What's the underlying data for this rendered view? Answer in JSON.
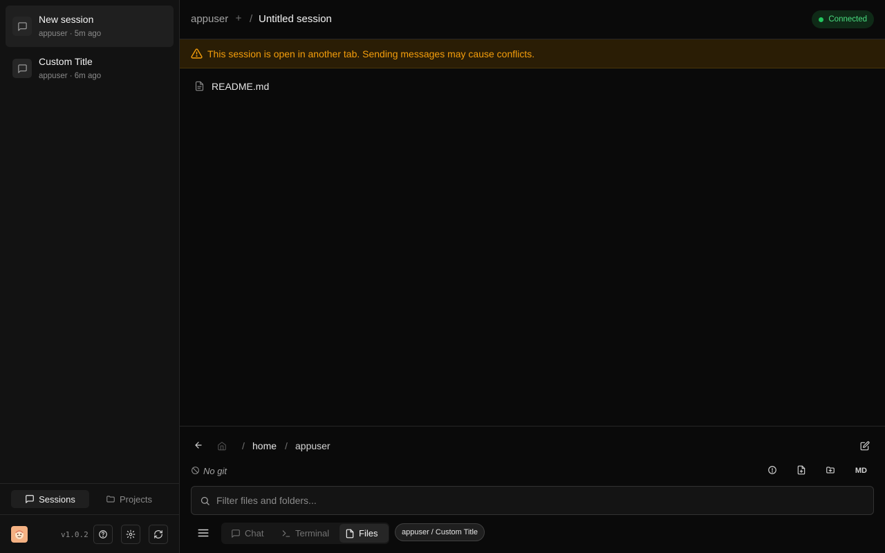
{
  "sidebar": {
    "sessions": [
      {
        "title": "New session",
        "meta": "appuser · 5m ago",
        "active": true
      },
      {
        "title": "Custom Title",
        "meta": "appuser · 6m ago",
        "active": false
      }
    ],
    "tabs": {
      "sessions": "Sessions",
      "projects": "Projects"
    },
    "version": "v1.0.2"
  },
  "header": {
    "user": "appuser",
    "separator": "/",
    "session_title": "Untitled session",
    "status": "Connected"
  },
  "warning": {
    "text": "This session is open in another tab. Sending messages may cause conflicts."
  },
  "files": [
    {
      "name": "README.md"
    }
  ],
  "explorer": {
    "separator": "/",
    "path": [
      "home",
      "appuser"
    ],
    "git_status": "No git",
    "md_label": "MD",
    "filter_placeholder": "Filter files and folders..."
  },
  "modes": {
    "chat": "Chat",
    "terminal": "Terminal",
    "files": "Files"
  },
  "context_chip": "appuser / Custom Title",
  "colors": {
    "warning": "#f59e0b",
    "connected": "#22c55e",
    "background": "#0a0a0a"
  }
}
